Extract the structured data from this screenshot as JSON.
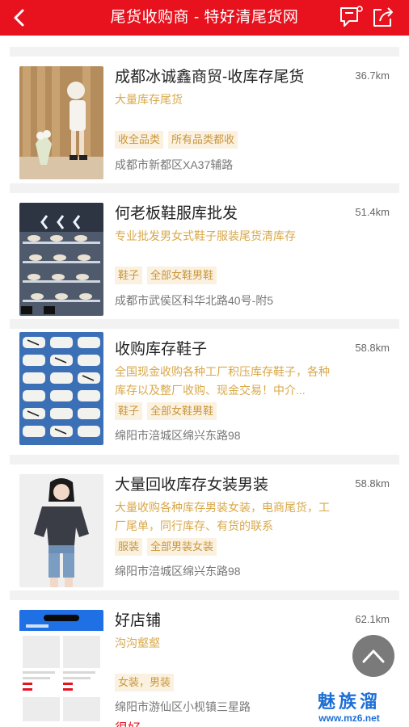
{
  "header": {
    "title": "尾货收购商 - 特好清尾货网"
  },
  "colors": {
    "brand": "#e8121e",
    "tag_text": "#c9963e",
    "desc_text": "#d9a84a",
    "watermark": "#1d6fd6"
  },
  "icons": {
    "back": "chevron-left-icon",
    "message": "message-icon",
    "share": "share-icon",
    "scroll_top": "chevron-up-icon"
  },
  "listings": [
    {
      "name": "成都冰诚鑫商贸-收库存尾货",
      "distance": "36.7km",
      "description": "大量库存尾货",
      "tags": [
        "收全品类",
        "所有品类都收"
      ],
      "address": "成都市新都区XA37辅路"
    },
    {
      "name": "何老板鞋服库批发",
      "distance": "51.4km",
      "description": "专业批发男女式鞋子服装尾货清库存",
      "tags": [
        "鞋子",
        "全部女鞋男鞋"
      ],
      "address": "成都市武侯区科华北路40号-附5"
    },
    {
      "name": "收购库存鞋子",
      "distance": "58.8km",
      "description": "全国现金收购各种工厂积压库存鞋子，各种库存以及整厂收购、现金交易！中介...",
      "tags": [
        "鞋子",
        "全部女鞋男鞋"
      ],
      "address": "绵阳市涪城区绵兴东路98"
    },
    {
      "name": "大量回收库存女装男装",
      "distance": "58.8km",
      "description": "大量收购各种库存男装女装，电商尾货，工厂尾单，同行库存、有货的联系",
      "tags": [
        "服装",
        "全部男装女装"
      ],
      "address": "绵阳市涪城区绵兴东路98"
    },
    {
      "name": "好店铺",
      "distance": "62.1km",
      "description": "沟沟壑壑",
      "tags": [
        "女装，男装"
      ],
      "address": "绵阳市游仙区小枧镇三星路"
    }
  ],
  "partial_text": "很好",
  "watermark": {
    "cn": "魅族溜",
    "url": "www.mz6.net"
  }
}
